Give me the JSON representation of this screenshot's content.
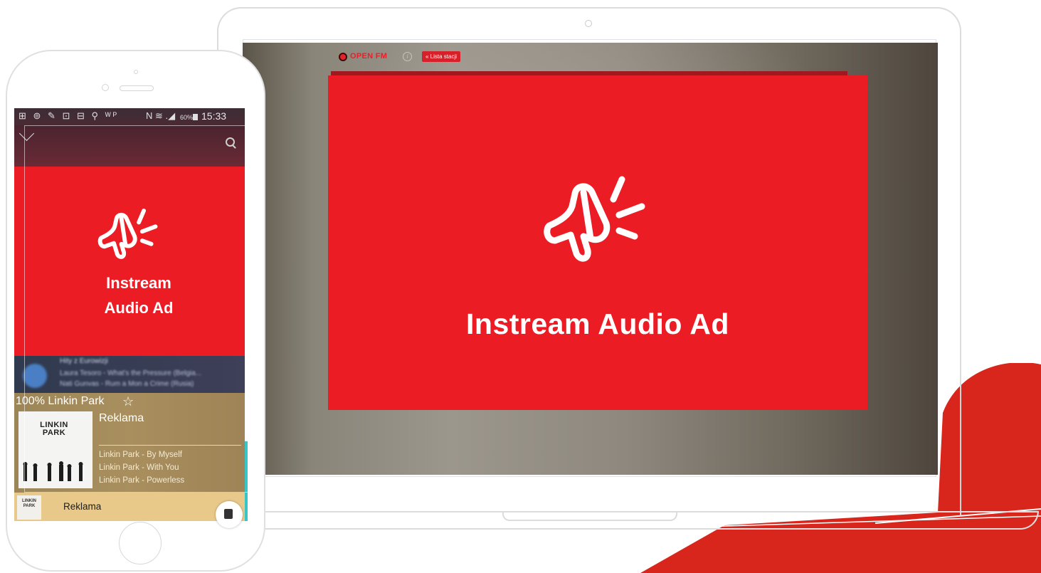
{
  "laptop": {
    "brand": "OPEN FM",
    "info_icon": "info-icon",
    "station_list_button": "« Lista stacji",
    "ad_title": "Instream Audio Ad",
    "ad_icon": "megaphone-icon"
  },
  "phone": {
    "status_bar": {
      "icons": "⊞ ⊚ ✎ ⊡ ⊟ ⚲ ᵂᴾ",
      "network": "N ≋ .◢",
      "battery": "60%",
      "time": "15:33"
    },
    "app_bar": {
      "back_icon": "chevron-down-icon",
      "search_icon": "search-icon"
    },
    "ad": {
      "title_line1": "Instream",
      "title_line2": "Audio Ad",
      "icon": "megaphone-icon"
    },
    "now_playing_blurred": {
      "title": "Hity z Eurowizji",
      "line1": "Laura Tesoro - What's the Pressure (Belgia...",
      "line2": "Nati Gunvas - Rum a Mon a Crime (Rusia)"
    },
    "station": {
      "title": "100% Linkin Park",
      "star_icon": "star-outline-icon",
      "current_label": "Reklama",
      "album_logo": "LINKIN PARK",
      "tracks": [
        "Linkin Park - By Myself",
        "Linkin Park - With You",
        "Linkin Park - Powerless"
      ]
    },
    "mini_player": {
      "art_text": "LINKIN PARK",
      "label": "Reklama",
      "stop_icon": "stop-icon"
    }
  },
  "colors": {
    "brand_red": "#ec1c24",
    "accent_red": "#d6202a",
    "track_panel": "#a58c5c",
    "mini_bar": "#e8c98a"
  }
}
